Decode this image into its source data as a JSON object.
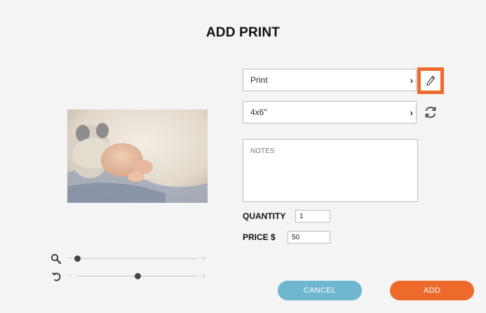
{
  "dialog": {
    "title": "ADD PRINT"
  },
  "product": {
    "type_value": "Print",
    "size_value": "4x6\""
  },
  "notes": {
    "placeholder": "NOTES"
  },
  "quantity": {
    "label": "QUANTITY",
    "value": "1"
  },
  "price": {
    "label": "PRICE $",
    "value": "50"
  },
  "zoom": {
    "icon": "search-icon",
    "level": 0.0
  },
  "rotate": {
    "icon": "rotate-icon",
    "level": 0.5
  },
  "buttons": {
    "cancel_label": "CANCEL",
    "add_label": "ADD"
  },
  "colors": {
    "accent": "#ec6a2b",
    "cancel": "#6fb6cf"
  }
}
